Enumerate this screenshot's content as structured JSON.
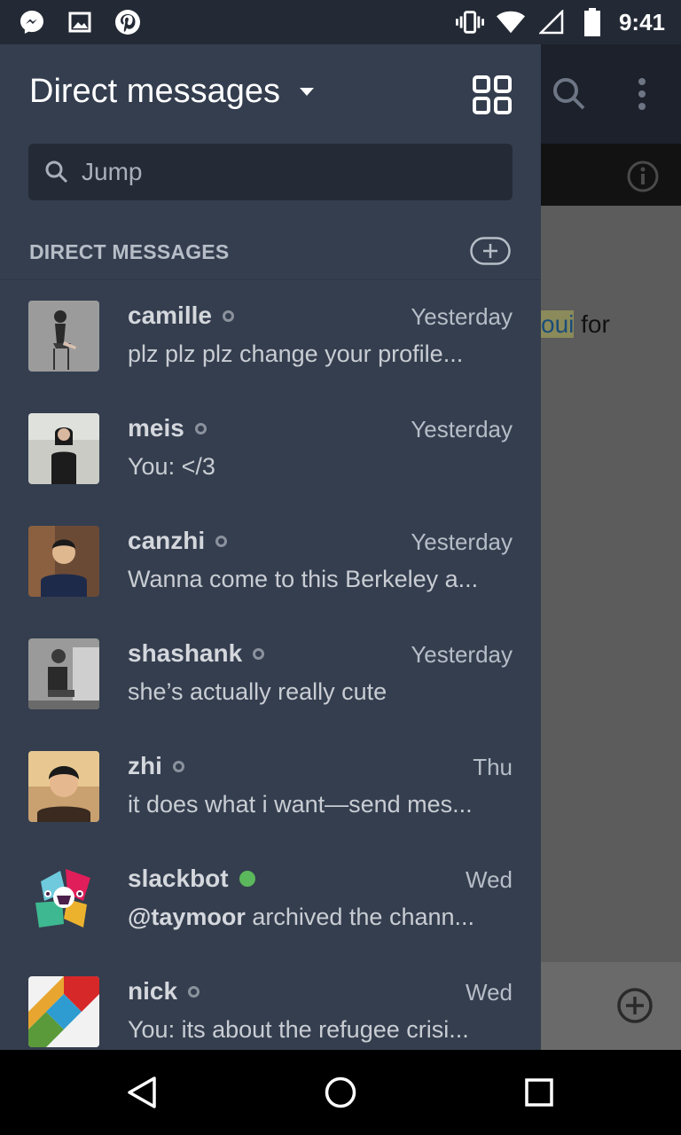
{
  "status_bar": {
    "time": "9:41",
    "left_icons": [
      "messenger-icon",
      "image-icon",
      "pinterest-icon"
    ],
    "right_icons": [
      "vibrate-icon",
      "wifi-icon",
      "signal-icon",
      "battery-icon"
    ]
  },
  "drawer": {
    "title": "Direct messages",
    "search": {
      "placeholder": "Jump"
    },
    "section_label": "DIRECT MESSAGES",
    "items": [
      {
        "name": "camille",
        "time": "Yesterday",
        "preview": "plz plz plz change your profile...",
        "status": "away"
      },
      {
        "name": "meis",
        "time": "Yesterday",
        "preview": "You: </3",
        "status": "away"
      },
      {
        "name": "canzhi",
        "time": "Yesterday",
        "preview": "Wanna come to this Berkeley a...",
        "status": "away"
      },
      {
        "name": "shashank",
        "time": "Yesterday",
        "preview": "she’s actually really cute",
        "status": "away"
      },
      {
        "name": "zhi",
        "time": "Thu",
        "preview": "it does what i want—send mes...",
        "status": "away"
      },
      {
        "name": "slackbot",
        "time": "Wed",
        "preview_bold": "@taymoor",
        "preview": " archived the chann...",
        "status": "active"
      },
      {
        "name": "nick",
        "time": "Wed",
        "preview": "You: its about the refugee crisi...",
        "status": "away"
      }
    ]
  },
  "background": {
    "snippet_highlight": "oui",
    "snippet_text": " for"
  },
  "colors": {
    "drawer_bg": "#343e4f",
    "status_bar_bg": "#242a35",
    "presence_active": "#5cb85c",
    "presence_away": "#8b929d"
  }
}
